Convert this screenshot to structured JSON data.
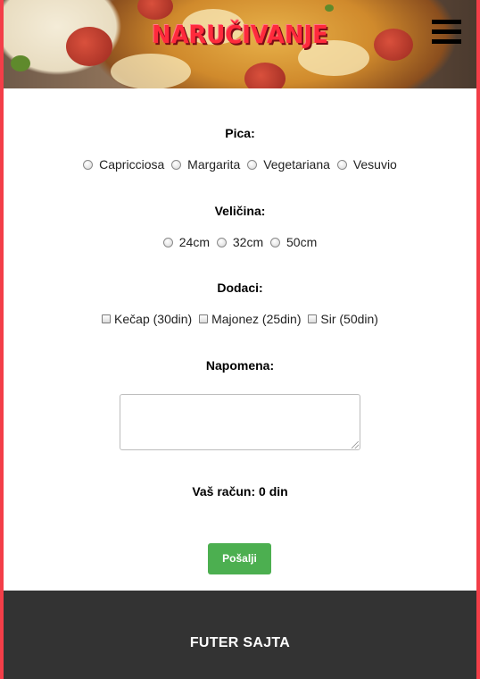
{
  "header": {
    "title": "NARUČIVANJE",
    "menu_icon": "hamburger-menu-icon"
  },
  "form": {
    "pizza": {
      "label": "Pica:",
      "options": [
        "Capricciosa",
        "Margarita",
        "Vegetariana",
        "Vesuvio"
      ]
    },
    "size": {
      "label": "Veličina:",
      "options": [
        "24cm",
        "32cm",
        "50cm"
      ]
    },
    "extras": {
      "label": "Dodaci:",
      "options": [
        "Kečap (30din)",
        "Majonez (25din)",
        "Sir (50din)"
      ]
    },
    "notes": {
      "label": "Napomena:",
      "value": ""
    },
    "total": {
      "label": "Vaš račun: 0 din"
    },
    "submit_label": "Pošalji"
  },
  "footer": {
    "title": "FUTER SAJTA"
  },
  "colors": {
    "side_border": "#f33e48",
    "title_red": "#ff2a3c",
    "submit_green": "#4caf50",
    "footer_bg": "#333333"
  }
}
